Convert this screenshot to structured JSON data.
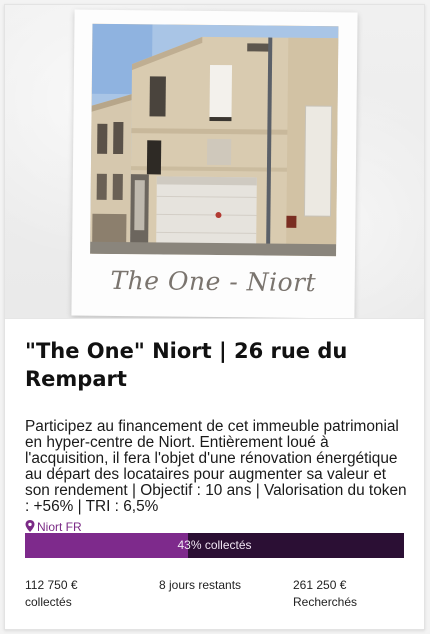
{
  "hero": {
    "caption": "The One - Niort",
    "photo_icon": "building-photo"
  },
  "project": {
    "title": "\"The One\" Niort | 26 rue du Rempart",
    "description": "Participez au financement de cet immeuble patrimonial en hyper-centre de Niort. Entièrement loué à l'acquisition, il fera l'objet d'une rénovation énergétique au départ des locataires pour augmenter sa valeur et son rendement | Objectif : 10 ans | Valorisation du token : +56% | TRI : 6,5%",
    "location": "Niort FR",
    "location_icon": "map-pin-icon"
  },
  "progress": {
    "percent": 43,
    "label": "43% collectés"
  },
  "stats": {
    "collected_value": "112 750 €",
    "collected_label": "collectés",
    "days_left": "8 jours restants",
    "target_value": "261 250 €",
    "target_label": "Recherchés"
  },
  "colors": {
    "accent": "#7e2a8c",
    "progress_track": "#2b0f34",
    "location_text": "#7b2a86"
  }
}
